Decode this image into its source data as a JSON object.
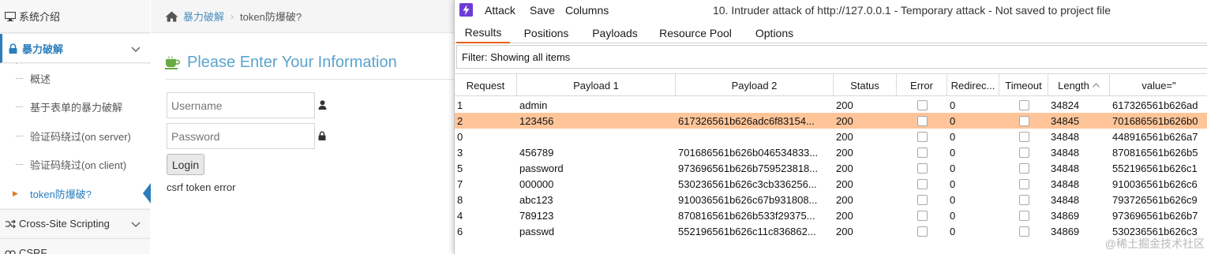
{
  "sidebar": {
    "top_item": "系统介绍",
    "section": "暴力破解",
    "sub_items": [
      "概述",
      "基于表单的暴力破解",
      "验证码绕过(on server)",
      "验证码绕过(on client)",
      "token防爆破?"
    ],
    "active_index": 4,
    "items_below": [
      "Cross-Site Scripting",
      "CSRF"
    ]
  },
  "main": {
    "breadcrumb": {
      "link": "暴力破解",
      "sep": "›",
      "current": "token防爆破?"
    },
    "heading": "Please Enter Your Information",
    "username_placeholder": "Username",
    "password_placeholder": "Password",
    "login_label": "Login",
    "error_text": "csrf token error"
  },
  "burp": {
    "menu": [
      "Attack",
      "Save",
      "Columns"
    ],
    "window_title": "10. Intruder attack of http://127.0.0.1 - Temporary attack - Not saved to project file",
    "tabs": [
      "Results",
      "Positions",
      "Payloads",
      "Resource Pool",
      "Options"
    ],
    "active_tab": "Results",
    "filter_text": "Filter: Showing all items",
    "columns": [
      "Request",
      "Payload 1",
      "Payload 2",
      "Status",
      "Error",
      "Redirec...",
      "Timeout",
      "Length",
      "value=\""
    ],
    "sort_column": "Length",
    "sort_icon": "sort-up-icon",
    "selected_row": 1,
    "rows": [
      {
        "request": "1",
        "payload1": "admin",
        "payload2": "",
        "status": "200",
        "redirect": "0",
        "length": "34824",
        "value": "617326561b626ad"
      },
      {
        "request": "2",
        "payload1": "123456",
        "payload2": "617326561b626adc6f83154...",
        "status": "200",
        "redirect": "0",
        "length": "34845",
        "value": "701686561b626b0"
      },
      {
        "request": "0",
        "payload1": "",
        "payload2": "",
        "status": "200",
        "redirect": "0",
        "length": "34848",
        "value": "448916561b626a7"
      },
      {
        "request": "3",
        "payload1": "456789",
        "payload2": "701686561b626b046534833...",
        "status": "200",
        "redirect": "0",
        "length": "34848",
        "value": "870816561b626b5"
      },
      {
        "request": "5",
        "payload1": "password",
        "payload2": "973696561b626b759523818...",
        "status": "200",
        "redirect": "0",
        "length": "34848",
        "value": "552196561b626c1"
      },
      {
        "request": "7",
        "payload1": "000000",
        "payload2": "530236561b626c3cb336256...",
        "status": "200",
        "redirect": "0",
        "length": "34848",
        "value": "910036561b626c6"
      },
      {
        "request": "8",
        "payload1": "abc123",
        "payload2": "910036561b626c67b931808...",
        "status": "200",
        "redirect": "0",
        "length": "34848",
        "value": "793726561b626c9"
      },
      {
        "request": "4",
        "payload1": "789123",
        "payload2": "870816561b626b533f29375...",
        "status": "200",
        "redirect": "0",
        "length": "34869",
        "value": "973696561b626b7"
      },
      {
        "request": "6",
        "payload1": "passwd",
        "payload2": "552196561b626c11c836862...",
        "status": "200",
        "redirect": "0",
        "length": "34869",
        "value": "530236561b626c3"
      }
    ]
  },
  "watermark": "@稀土掘金技术社区",
  "colors": {
    "accent": "#2b7dbc",
    "heading": "#5ba3cf",
    "selected_row": "#ffc599",
    "active_tab_underline": "#e8611a",
    "burp_logo": "#6d3cd6"
  }
}
